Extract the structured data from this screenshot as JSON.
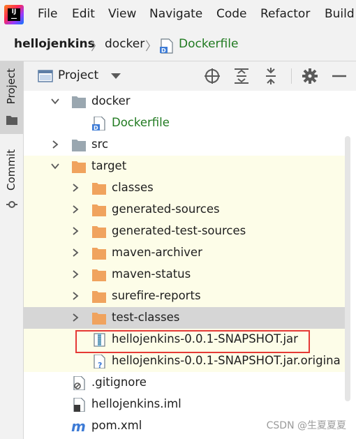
{
  "menubar": {
    "items": [
      "File",
      "Edit",
      "View",
      "Navigate",
      "Code",
      "Refactor",
      "Build"
    ]
  },
  "breadcrumb": {
    "project": "hellojenkins",
    "folder": "docker",
    "file": "Dockerfile"
  },
  "toolstrip": {
    "project_tab": "Project",
    "commit_tab": "Commit"
  },
  "panel": {
    "view_name": "Project"
  },
  "tree": [
    {
      "label": "docker",
      "type": "folder-grey",
      "expanded": true,
      "style": "normal"
    },
    {
      "label": "Dockerfile",
      "type": "docker-file",
      "style": "green"
    },
    {
      "label": "src",
      "type": "folder-grey",
      "expanded": false,
      "style": "normal"
    },
    {
      "label": "target",
      "type": "folder-orange",
      "expanded": true,
      "style": "ignored"
    },
    {
      "label": "classes",
      "type": "folder-orange",
      "expanded": false,
      "style": "ignored"
    },
    {
      "label": "generated-sources",
      "type": "folder-orange",
      "expanded": false,
      "style": "ignored"
    },
    {
      "label": "generated-test-sources",
      "type": "folder-orange",
      "expanded": false,
      "style": "ignored"
    },
    {
      "label": "maven-archiver",
      "type": "folder-orange",
      "expanded": false,
      "style": "ignored"
    },
    {
      "label": "maven-status",
      "type": "folder-orange",
      "expanded": false,
      "style": "ignored"
    },
    {
      "label": "surefire-reports",
      "type": "folder-orange",
      "expanded": false,
      "style": "ignored"
    },
    {
      "label": "test-classes",
      "type": "folder-orange",
      "expanded": false,
      "style": "selected"
    },
    {
      "label": "hellojenkins-0.0.1-SNAPSHOT.jar",
      "type": "jar",
      "style": "ignored"
    },
    {
      "label": "hellojenkins-0.0.1-SNAPSHOT.jar.origina",
      "type": "unknown-file",
      "style": "ignored"
    },
    {
      "label": ".gitignore",
      "type": "gitignore",
      "style": "normal"
    },
    {
      "label": "hellojenkins.iml",
      "type": "iml",
      "style": "normal"
    },
    {
      "label": "pom.xml",
      "type": "maven",
      "style": "normal"
    }
  ],
  "watermark": "CSDN @生夏夏夏",
  "colors": {
    "ignored_row": "#fdfde8",
    "selected_row": "#d6d6d6",
    "folder_orange": "#f0a35e",
    "folder_grey": "#9aa7b0",
    "highlight": "#e53935",
    "vcs_added": "#207a20"
  }
}
